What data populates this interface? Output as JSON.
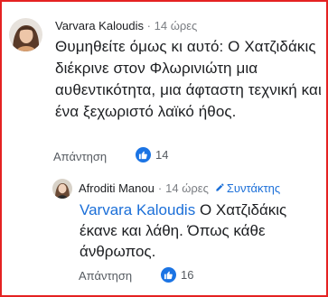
{
  "comments": [
    {
      "author": "Varvara Kaloudis",
      "time": "14 ώρες",
      "text": "Θυμηθείτε όμως κι αυτό: Ο Χατζιδάκις διέκρινε στον Φλωρινιώτη μια αυθεντικότητα, μια άφταστη τεχνική και ένα ξεχωριστό λαϊκό ήθος.",
      "reply_label": "Απάντηση",
      "likes": "14"
    },
    {
      "author": "Afroditi Manou",
      "time": "14 ώρες",
      "author_badge": "Συντάκτης",
      "mention": "Varvara Kaloudis",
      "text": "Ο Χατζιδάκις έκανε και λάθη. Όπως κάθε άνθρωπος.",
      "reply_label": "Απάντηση",
      "likes": "16"
    }
  ],
  "separator": "·",
  "colors": {
    "accent": "#1b6fd8",
    "like_badge": "#1b74e4",
    "frame_border": "#e52222",
    "meta_text": "#7a7d82"
  },
  "icons": {
    "like": "thumbs-up-icon",
    "author_badge": "pencil-icon"
  }
}
